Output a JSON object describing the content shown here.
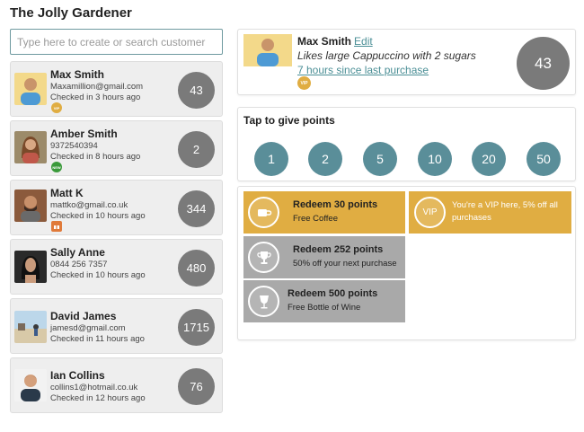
{
  "app": {
    "title": "The Jolly Gardener"
  },
  "search": {
    "placeholder": "Type here to create or search customer"
  },
  "customers": [
    {
      "name": "Max Smith",
      "contact": "Maxamillion@gmail.com",
      "checked": "Checked in 3 hours ago",
      "points": "43",
      "badge": "VIP",
      "badge_color": "#e0ad42"
    },
    {
      "name": "Amber Smith",
      "contact": "9372540394",
      "checked": "Checked in 8 hours ago",
      "points": "2",
      "badge": "NEW",
      "badge_color": "#3a9a3a"
    },
    {
      "name": "Matt K",
      "contact": "mattko@gmail.co.uk",
      "checked": "Checked in 10 hours ago",
      "points": "344",
      "badge": "",
      "badge_color": "#e07a3a"
    },
    {
      "name": "Sally Anne",
      "contact": "0844 256 7357",
      "checked": "Checked in 10 hours ago",
      "points": "480"
    },
    {
      "name": "David James",
      "contact": "jamesd@gmail.com",
      "checked": "Checked in 11 hours ago",
      "points": "1715"
    },
    {
      "name": "Ian Collins",
      "contact": "collins1@hotmail.co.uk",
      "checked": "Checked in 12 hours ago",
      "points": "76"
    }
  ],
  "detail": {
    "name": "Max Smith",
    "edit_label": "Edit",
    "preference": "Likes large Cappuccino with 2 sugars",
    "last_purchase": "7 hours since last purchase",
    "badge": "VIP",
    "points": "43"
  },
  "points_panel": {
    "title": "Tap to give points",
    "options": [
      "1",
      "2",
      "5",
      "10",
      "20",
      "50"
    ]
  },
  "rewards": [
    {
      "title": "Redeem 30 points",
      "subtitle": "Free Coffee",
      "icon": "coffee-cup-icon"
    },
    {
      "title": "Redeem 252 points",
      "subtitle": "50% off your next purchase",
      "icon": "trophy-icon"
    },
    {
      "title": "Redeem 500 points",
      "subtitle": "Free Bottle of Wine",
      "icon": "wine-glass-icon"
    }
  ],
  "vip_banner": {
    "badge": "VIP",
    "text": "You're a VIP here, 5% off all purchases"
  },
  "colors": {
    "accent": "#5a8e99",
    "link": "#4b8f96",
    "gold": "#e0ad42",
    "points_grey": "#7a7a7a",
    "reward_grey": "#a9a9a9"
  }
}
